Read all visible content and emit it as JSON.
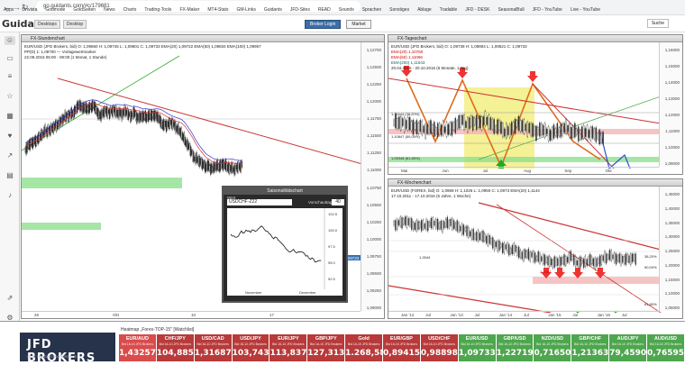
{
  "browser": {
    "url": "go.guidants.com/#c/179681",
    "bookmarks": [
      "Apps",
      "Onvista",
      "Godmode",
      "GoldSeiten",
      "News",
      "Charts",
      "Trading-Tools",
      "FX-Maker",
      "MT4-Stats",
      "GM-Links",
      "Guidants",
      "JFD-Sites",
      "READ",
      "Sounds",
      "Sprachen",
      "Sonstiges",
      "Ablage",
      "Tradable",
      "JFD - DESK",
      "SeasonalBull",
      "JFD - YouTube",
      "Live - YouTube"
    ]
  },
  "app": {
    "logo": "Guidants",
    "top_buttons": [
      "Desktops",
      "Desktop"
    ],
    "mid_buttons": [
      "Broker Login",
      "Market"
    ],
    "search": "Suche"
  },
  "panels": {
    "hourly": {
      "title": "FX-Stundenchart",
      "info": [
        "EUR/USD (JFD Brokers, bid) O: 1,09660 H: 1,09745 L: 1,09601 C: 1,09733  EMA(20) 1,09722  EMA(50) 1,09834  EMA(100) 1,09957",
        "PP(D) 1: 1,09700 — Vorlagewertmarker",
        "22.09.2016 06:00 - 09:00 (1 Monat, 1 Stunde)"
      ],
      "y_labels": [
        "1,12700",
        "1,12500",
        "1,12250",
        "1,12000",
        "1,11750",
        "1,11500",
        "1,11250",
        "1,11000",
        "1,10750",
        "1,10500",
        "1,10250",
        "1,10000",
        "1,09750",
        "1,09500",
        "1,09250",
        "1,09000"
      ],
      "x_labels": [
        "26",
        "Okt",
        "10",
        "17"
      ],
      "price_tag": "1,09733"
    },
    "daily": {
      "title": "FX-Tageschart",
      "info": [
        "EUR/USD (JFD Brokers, bid) O: 1,09739 H: 1,09804 L: 1,09521 C: 1,09733",
        "EMA(20) 1,10760",
        "EMA(50) 1,11066",
        "EMA(200) 1,11643",
        "20.04.2016 - 20.10.2016 (6 Monate, 1 Tag)"
      ],
      "annotations": [
        "1,11644 (38,20%)",
        "1,10847 (50,00%)",
        "1,09348 (61,80%)"
      ],
      "y_labels": [
        "1,16000",
        "1,15000",
        "1,14000",
        "1,13000",
        "1,12000",
        "1,11000",
        "1,10000",
        "1,09000"
      ],
      "x_labels": [
        "Mai",
        "Jun",
        "Jul",
        "Aug",
        "Sep",
        "Okt"
      ]
    },
    "weekly": {
      "title": "FX-Wochenchart",
      "info": [
        "EUR/USD (FOREX, bid) O: 1,0969 H: 1,1026 L: 1,0950 C: 1,0973  EMA(20) 1,1144",
        "17.10.2011 - 17.10.2016 (5 Jahre, 1 Woche)"
      ],
      "annotations": [
        "1,2644",
        "1,1482",
        "38,20%",
        "50,00%",
        "61,80%"
      ],
      "y_labels": [
        "1,45000",
        "1,40000",
        "1,35000",
        "1,30000",
        "1,25000",
        "1,20000",
        "1,15000",
        "1,10000",
        "1,05000"
      ],
      "x_labels": [
        "Jan '12",
        "Jul",
        "Jan '13",
        "Jul",
        "Jan '14",
        "Jul",
        "Jan '15",
        "Jul",
        "Jan '16",
        "Jul"
      ]
    }
  },
  "float_window": {
    "title": "Saisonalitätschart",
    "label": "Wert",
    "symbol": "USDCHF-Z22",
    "qty_label": "Vorschauttage",
    "qty": "40",
    "x_labels": [
      "November",
      "Dezember"
    ],
    "y_labels": [
      "102.5",
      "100.0",
      "97.5",
      "95.0",
      "92.5"
    ]
  },
  "broker": {
    "name": "JFD BROKERS",
    "tagline": "GIVE TRADING EXPERIENCE"
  },
  "heatmap": {
    "title": "Heatmap „Forex-TOP-15\" [Watchlist]",
    "cells": [
      {
        "sym": "EUR/AUD",
        "sub": "Bid 16-10 JFD Brokers",
        "val": "1,43257",
        "color": "red"
      },
      {
        "sym": "CHF/JPY",
        "sub": "Bid 16-10 JFD Brokers",
        "val": "104,88500",
        "color": "dred"
      },
      {
        "sym": "USD/CAD",
        "sub": "Bid 16-10 JFD Brokers",
        "val": "1,31687",
        "color": "dred"
      },
      {
        "sym": "USD/JPY",
        "sub": "Bid 16-10 JFD Brokers",
        "val": "103,74300",
        "color": "dred"
      },
      {
        "sym": "EUR/JPY",
        "sub": "Bid 16-10 JFD Brokers",
        "val": "113,83700",
        "color": "dred"
      },
      {
        "sym": "GBP/JPY",
        "sub": "Bid 16-10 JFD Brokers",
        "val": "127,31300",
        "color": "dred"
      },
      {
        "sym": "Gold",
        "sub": "Bid 16-10 JFD Brokers",
        "val": "1.268,58",
        "color": "dred"
      },
      {
        "sym": "EUR/GBP",
        "sub": "Bid 16-10 JFD Brokers",
        "val": "0,89415",
        "color": "dred"
      },
      {
        "sym": "USD/CHF",
        "sub": "Bid 16-10 JFD Brokers",
        "val": "0,98898",
        "color": "dred"
      },
      {
        "sym": "EUR/USD",
        "sub": "Bid 16-10 JFD Brokers",
        "val": "1,09733",
        "color": "green"
      },
      {
        "sym": "GBP/USD",
        "sub": "Bid 16-10 JFD Brokers",
        "val": "1,22719",
        "color": "green"
      },
      {
        "sym": "NZD/USD",
        "sub": "Bid 16-10 JFD Brokers",
        "val": "0,71650",
        "color": "green"
      },
      {
        "sym": "GBP/CHF",
        "sub": "Bid 16-10 JFD Brokers",
        "val": "1,21363",
        "color": "green"
      },
      {
        "sym": "AUD/JPY",
        "sub": "Bid 16-10 JFD Brokers",
        "val": "79,45900",
        "color": "green"
      },
      {
        "sym": "AUD/USD",
        "sub": "Bid 16-10 JFD Brokers",
        "val": "0,76595",
        "color": "green"
      }
    ]
  }
}
